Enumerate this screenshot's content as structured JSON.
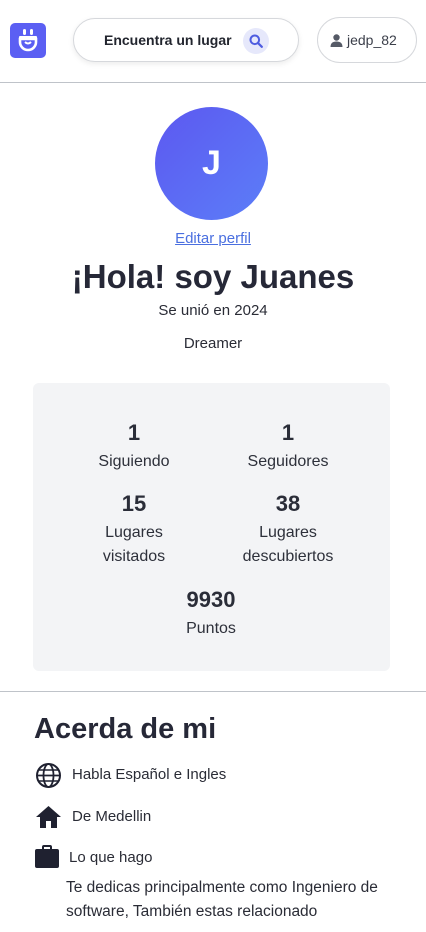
{
  "header": {
    "logo_icon": "app-logo-icon",
    "search_label": "Encuentra un lugar",
    "search_icon": "search-icon",
    "user_icon": "person-icon",
    "username": "jedp_82"
  },
  "profile": {
    "avatar_initial": "J",
    "edit_link": "Editar perfil",
    "greeting": "¡Hola! soy Juanes",
    "joined": "Se unió en 2024",
    "role": "Dreamer"
  },
  "stats": {
    "following": {
      "value": "1",
      "label": "Siguiendo"
    },
    "followers": {
      "value": "1",
      "label": "Seguidores"
    },
    "visited": {
      "value": "15",
      "label_line1": "Lugares",
      "label_line2": "visitados"
    },
    "discovered": {
      "value": "38",
      "label_line1": "Lugares",
      "label_line2": "descubiertos"
    },
    "points": {
      "value": "9930",
      "label": "Puntos"
    }
  },
  "about": {
    "title": "Acerda de mi",
    "languages": "Habla Español e Ingles",
    "location": "De Medellin",
    "work_title": "Lo que hago",
    "work_description": "Te dedicas principalmente como Ingeniero de software, También estas relacionado"
  },
  "colors": {
    "brand": "#5b5ff3",
    "link": "#4a6fe0",
    "stats_bg": "#f3f4f6"
  }
}
